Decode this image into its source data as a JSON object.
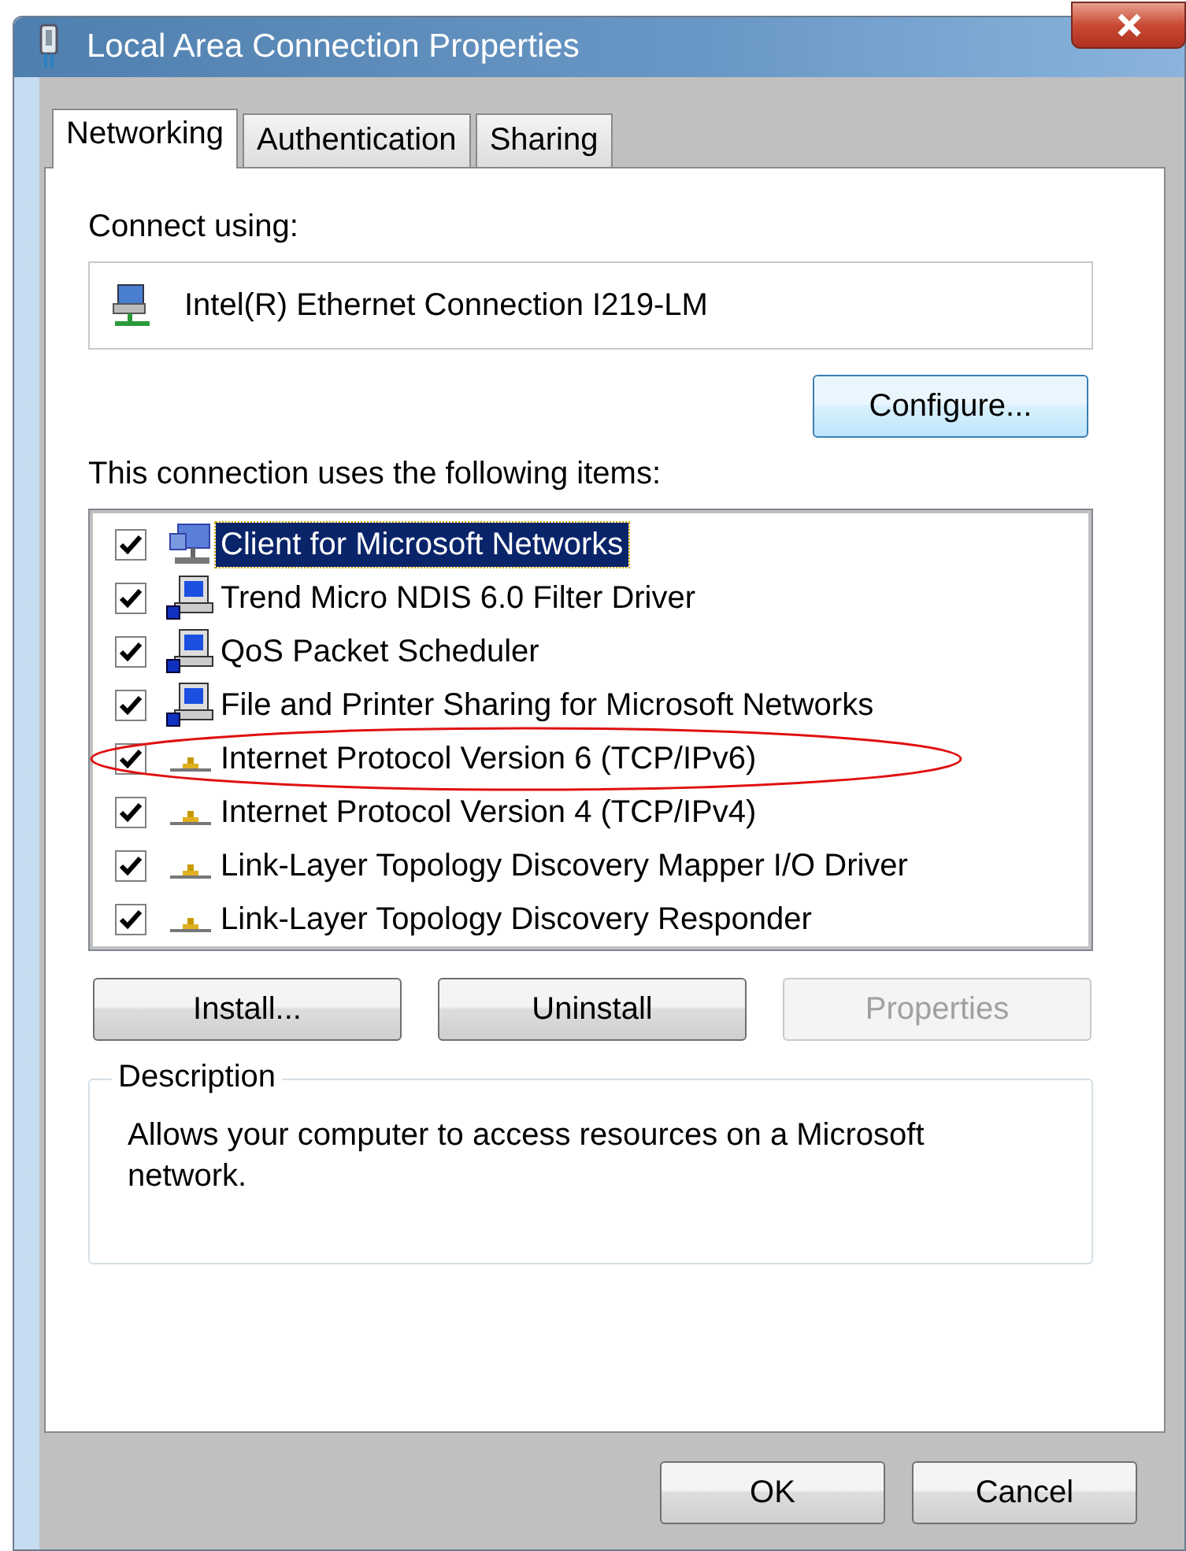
{
  "window": {
    "title": "Local Area Connection Properties"
  },
  "tabs": [
    {
      "label": "Networking",
      "selected": true
    },
    {
      "label": "Authentication",
      "selected": false
    },
    {
      "label": "Sharing",
      "selected": false
    }
  ],
  "connect_using": {
    "label": "Connect using:",
    "adapter": "Intel(R) Ethernet Connection I219-LM"
  },
  "configure_button": "Configure...",
  "items_label": "This connection uses the following items:",
  "items": [
    {
      "label": "Client for Microsoft Networks",
      "kind": "client",
      "checked": true,
      "selected": true,
      "circled": false
    },
    {
      "label": "Trend Micro NDIS 6.0 Filter Driver",
      "kind": "service",
      "checked": true,
      "selected": false,
      "circled": false
    },
    {
      "label": "QoS Packet Scheduler",
      "kind": "service",
      "checked": true,
      "selected": false,
      "circled": false
    },
    {
      "label": "File and Printer Sharing for Microsoft Networks",
      "kind": "service",
      "checked": true,
      "selected": false,
      "circled": false
    },
    {
      "label": "Internet Protocol Version 6 (TCP/IPv6)",
      "kind": "protocol",
      "checked": true,
      "selected": false,
      "circled": true
    },
    {
      "label": "Internet Protocol Version 4 (TCP/IPv4)",
      "kind": "protocol",
      "checked": true,
      "selected": false,
      "circled": false
    },
    {
      "label": "Link-Layer Topology Discovery Mapper I/O Driver",
      "kind": "protocol",
      "checked": true,
      "selected": false,
      "circled": false
    },
    {
      "label": "Link-Layer Topology Discovery Responder",
      "kind": "protocol",
      "checked": true,
      "selected": false,
      "circled": false
    }
  ],
  "item_buttons": [
    {
      "label": "Install...",
      "disabled": false
    },
    {
      "label": "Uninstall",
      "disabled": false
    },
    {
      "label": "Properties",
      "disabled": true
    }
  ],
  "description": {
    "title": "Description",
    "text": "Allows your computer to access resources on a Microsoft network."
  },
  "dialog_buttons": [
    "OK",
    "Cancel"
  ]
}
